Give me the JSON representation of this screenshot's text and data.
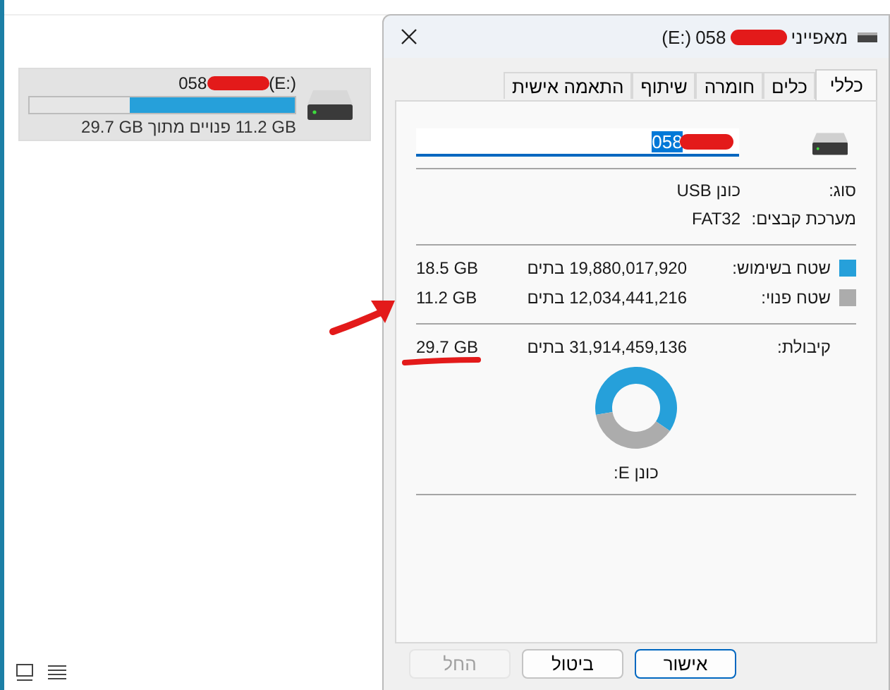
{
  "explorer": {
    "drive": {
      "name": "058",
      "letter": "(E:)",
      "level": 0.62,
      "summary": {
        "free": "11.2 GB",
        "middle": "פנויים מתוך",
        "total": "29.7 GB"
      }
    }
  },
  "dialog": {
    "title_prefix": "מאפייני",
    "title_name": "058",
    "title_letter": "(E:)",
    "tabs": [
      {
        "label": "כללי",
        "selected": true
      },
      {
        "label": "כלים",
        "selected": false
      },
      {
        "label": "חומרה",
        "selected": false
      },
      {
        "label": "שיתוף",
        "selected": false
      },
      {
        "label": "התאמה אישית",
        "selected": false
      }
    ],
    "name_value": "058",
    "properties": [
      {
        "label": "סוג:",
        "value": "כונן USB"
      },
      {
        "label": "מערכת קבצים:",
        "value": "FAT32"
      }
    ],
    "space": [
      {
        "label": "שטח בשימוש:",
        "bytes": "19,880,017,920 בתים",
        "size": "18.5 GB",
        "color": "#26a0da"
      },
      {
        "label": "שטח פנוי:",
        "bytes": "12,034,441,216 בתים",
        "size": "11.2 GB",
        "color": "#acacac"
      }
    ],
    "capacity": {
      "label": "קיבולת:",
      "bytes": "31,914,459,136 בתים",
      "size": "29.7 GB"
    },
    "usage_donut": {
      "chart_data": {
        "type": "donut",
        "values": [
          62.3,
          37.7
        ]
      }
    },
    "drive_caption": "כונן E:",
    "buttons": [
      {
        "label": "אישור",
        "kind": "primary",
        "disabled": false
      },
      {
        "label": "ביטול",
        "kind": "normal",
        "disabled": false
      },
      {
        "label": "החל",
        "kind": "normal",
        "disabled": true
      }
    ]
  }
}
